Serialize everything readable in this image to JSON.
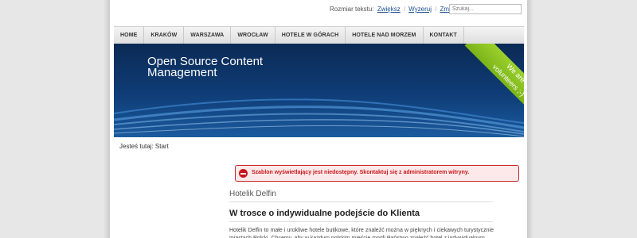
{
  "topbar": {
    "font_size_label": "Rozmiar tekstu:",
    "increase_label": "Zwiększ",
    "reset_label": "Wyzeruj",
    "decrease_label": "Zmniejsz",
    "search_placeholder": "Szukaj..."
  },
  "nav": {
    "items": [
      {
        "label": "HOME"
      },
      {
        "label": "KRAKÓW"
      },
      {
        "label": "WARSZAWA"
      },
      {
        "label": "WROCŁAW"
      },
      {
        "label": "HOTELE W GÓRACH"
      },
      {
        "label": "HOTELE NAD MORZEM"
      },
      {
        "label": "KONTAKT"
      }
    ]
  },
  "banner": {
    "title": "Open Source Content Management",
    "ribbon_line1": "We are",
    "ribbon_line2": "volunteers ;-)"
  },
  "breadcrumb": {
    "text": "Jesteś tutaj: Start"
  },
  "error": {
    "message": "Szablon wyświetlający jest niedostępny. Skontaktuj się z administratorem witryny."
  },
  "article": {
    "heading": "Hotelik Delfin",
    "title": "W trosce o indywidualne podejście do Klienta",
    "body": "Hotelik Delfin to małe i urokliwe hotele butikowe, które znaleźć można w pięknych i ciekawych turystycznie miastach Polski. Chcemy, aby w każdym polskim mieście mogli Państwo znaleźć hotel z indywidualnym"
  },
  "colors": {
    "error": "#c8151b",
    "ribbon": "#8cc21f",
    "banner": "#0f3d77",
    "link": "#1a4f8f"
  }
}
